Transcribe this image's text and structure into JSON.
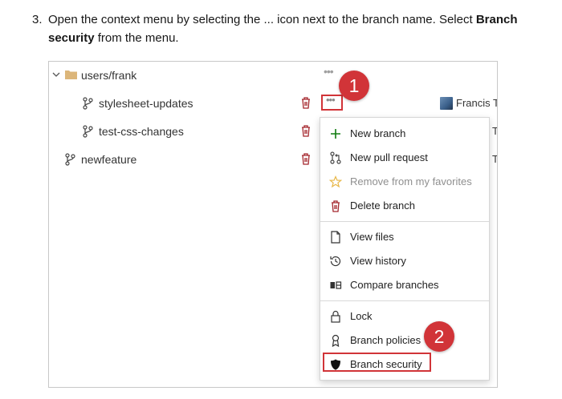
{
  "instruction": {
    "number": "3.",
    "part1": "Open the context menu by selecting the ... icon next to the branch name. Select ",
    "bold": "Branch security",
    "part2": " from the menu."
  },
  "tree": {
    "folder_label": "users/frank",
    "more_label": "•••",
    "rows": [
      {
        "label": "stylesheet-updates"
      },
      {
        "label": "test-css-changes"
      },
      {
        "label": "newfeature"
      }
    ],
    "author_row1": "Francis To",
    "author_cut": "To"
  },
  "menu": {
    "group1": [
      {
        "label": "New branch",
        "icon": "plus-icon"
      },
      {
        "label": "New pull request",
        "icon": "pull-request-icon"
      },
      {
        "label": "Remove from my favorites",
        "icon": "star-icon",
        "disabled": true
      },
      {
        "label": "Delete branch",
        "icon": "trash-icon"
      }
    ],
    "group2": [
      {
        "label": "View files",
        "icon": "file-icon"
      },
      {
        "label": "View history",
        "icon": "history-icon"
      },
      {
        "label": "Compare branches",
        "icon": "compare-icon"
      }
    ],
    "group3": [
      {
        "label": "Lock",
        "icon": "lock-icon"
      },
      {
        "label": "Branch policies",
        "icon": "policy-icon"
      },
      {
        "label": "Branch security",
        "icon": "shield-icon"
      }
    ]
  },
  "callouts": {
    "one": "1",
    "two": "2"
  },
  "colors": {
    "accent": "#d13438",
    "folder": "#dcb67a",
    "plus": "#107c10",
    "trash": "#a4262c"
  }
}
